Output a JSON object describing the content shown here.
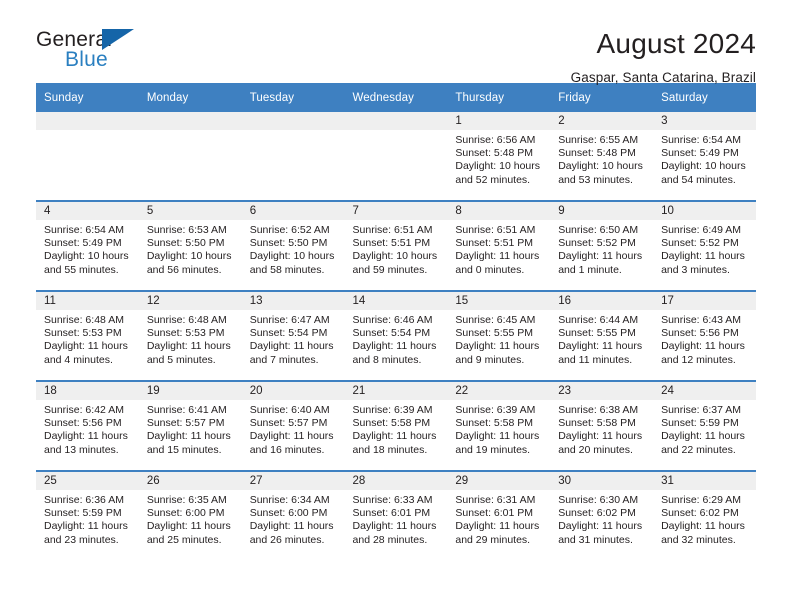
{
  "brand": {
    "name_part1": "General",
    "name_part2": "Blue",
    "flag_icon": "blue-flag-triangle",
    "accent_color": "#2a7fc0"
  },
  "header": {
    "title": "August 2024",
    "subtitle": "Gaspar, Santa Catarina, Brazil"
  },
  "calendar": {
    "header_bg": "#3e80c1",
    "daynum_bg": "#efefef",
    "weekday_headers": [
      "Sunday",
      "Monday",
      "Tuesday",
      "Wednesday",
      "Thursday",
      "Friday",
      "Saturday"
    ],
    "labels": {
      "sunrise": "Sunrise:",
      "sunset": "Sunset:",
      "daylight": "Daylight:"
    },
    "weeks": [
      [
        {
          "day": "",
          "sunrise": "",
          "sunset": "",
          "daylight": ""
        },
        {
          "day": "",
          "sunrise": "",
          "sunset": "",
          "daylight": ""
        },
        {
          "day": "",
          "sunrise": "",
          "sunset": "",
          "daylight": ""
        },
        {
          "day": "",
          "sunrise": "",
          "sunset": "",
          "daylight": ""
        },
        {
          "day": "1",
          "sunrise": "Sunrise: 6:56 AM",
          "sunset": "Sunset: 5:48 PM",
          "daylight": "Daylight: 10 hours and 52 minutes."
        },
        {
          "day": "2",
          "sunrise": "Sunrise: 6:55 AM",
          "sunset": "Sunset: 5:48 PM",
          "daylight": "Daylight: 10 hours and 53 minutes."
        },
        {
          "day": "3",
          "sunrise": "Sunrise: 6:54 AM",
          "sunset": "Sunset: 5:49 PM",
          "daylight": "Daylight: 10 hours and 54 minutes."
        }
      ],
      [
        {
          "day": "4",
          "sunrise": "Sunrise: 6:54 AM",
          "sunset": "Sunset: 5:49 PM",
          "daylight": "Daylight: 10 hours and 55 minutes."
        },
        {
          "day": "5",
          "sunrise": "Sunrise: 6:53 AM",
          "sunset": "Sunset: 5:50 PM",
          "daylight": "Daylight: 10 hours and 56 minutes."
        },
        {
          "day": "6",
          "sunrise": "Sunrise: 6:52 AM",
          "sunset": "Sunset: 5:50 PM",
          "daylight": "Daylight: 10 hours and 58 minutes."
        },
        {
          "day": "7",
          "sunrise": "Sunrise: 6:51 AM",
          "sunset": "Sunset: 5:51 PM",
          "daylight": "Daylight: 10 hours and 59 minutes."
        },
        {
          "day": "8",
          "sunrise": "Sunrise: 6:51 AM",
          "sunset": "Sunset: 5:51 PM",
          "daylight": "Daylight: 11 hours and 0 minutes."
        },
        {
          "day": "9",
          "sunrise": "Sunrise: 6:50 AM",
          "sunset": "Sunset: 5:52 PM",
          "daylight": "Daylight: 11 hours and 1 minute."
        },
        {
          "day": "10",
          "sunrise": "Sunrise: 6:49 AM",
          "sunset": "Sunset: 5:52 PM",
          "daylight": "Daylight: 11 hours and 3 minutes."
        }
      ],
      [
        {
          "day": "11",
          "sunrise": "Sunrise: 6:48 AM",
          "sunset": "Sunset: 5:53 PM",
          "daylight": "Daylight: 11 hours and 4 minutes."
        },
        {
          "day": "12",
          "sunrise": "Sunrise: 6:48 AM",
          "sunset": "Sunset: 5:53 PM",
          "daylight": "Daylight: 11 hours and 5 minutes."
        },
        {
          "day": "13",
          "sunrise": "Sunrise: 6:47 AM",
          "sunset": "Sunset: 5:54 PM",
          "daylight": "Daylight: 11 hours and 7 minutes."
        },
        {
          "day": "14",
          "sunrise": "Sunrise: 6:46 AM",
          "sunset": "Sunset: 5:54 PM",
          "daylight": "Daylight: 11 hours and 8 minutes."
        },
        {
          "day": "15",
          "sunrise": "Sunrise: 6:45 AM",
          "sunset": "Sunset: 5:55 PM",
          "daylight": "Daylight: 11 hours and 9 minutes."
        },
        {
          "day": "16",
          "sunrise": "Sunrise: 6:44 AM",
          "sunset": "Sunset: 5:55 PM",
          "daylight": "Daylight: 11 hours and 11 minutes."
        },
        {
          "day": "17",
          "sunrise": "Sunrise: 6:43 AM",
          "sunset": "Sunset: 5:56 PM",
          "daylight": "Daylight: 11 hours and 12 minutes."
        }
      ],
      [
        {
          "day": "18",
          "sunrise": "Sunrise: 6:42 AM",
          "sunset": "Sunset: 5:56 PM",
          "daylight": "Daylight: 11 hours and 13 minutes."
        },
        {
          "day": "19",
          "sunrise": "Sunrise: 6:41 AM",
          "sunset": "Sunset: 5:57 PM",
          "daylight": "Daylight: 11 hours and 15 minutes."
        },
        {
          "day": "20",
          "sunrise": "Sunrise: 6:40 AM",
          "sunset": "Sunset: 5:57 PM",
          "daylight": "Daylight: 11 hours and 16 minutes."
        },
        {
          "day": "21",
          "sunrise": "Sunrise: 6:39 AM",
          "sunset": "Sunset: 5:58 PM",
          "daylight": "Daylight: 11 hours and 18 minutes."
        },
        {
          "day": "22",
          "sunrise": "Sunrise: 6:39 AM",
          "sunset": "Sunset: 5:58 PM",
          "daylight": "Daylight: 11 hours and 19 minutes."
        },
        {
          "day": "23",
          "sunrise": "Sunrise: 6:38 AM",
          "sunset": "Sunset: 5:58 PM",
          "daylight": "Daylight: 11 hours and 20 minutes."
        },
        {
          "day": "24",
          "sunrise": "Sunrise: 6:37 AM",
          "sunset": "Sunset: 5:59 PM",
          "daylight": "Daylight: 11 hours and 22 minutes."
        }
      ],
      [
        {
          "day": "25",
          "sunrise": "Sunrise: 6:36 AM",
          "sunset": "Sunset: 5:59 PM",
          "daylight": "Daylight: 11 hours and 23 minutes."
        },
        {
          "day": "26",
          "sunrise": "Sunrise: 6:35 AM",
          "sunset": "Sunset: 6:00 PM",
          "daylight": "Daylight: 11 hours and 25 minutes."
        },
        {
          "day": "27",
          "sunrise": "Sunrise: 6:34 AM",
          "sunset": "Sunset: 6:00 PM",
          "daylight": "Daylight: 11 hours and 26 minutes."
        },
        {
          "day": "28",
          "sunrise": "Sunrise: 6:33 AM",
          "sunset": "Sunset: 6:01 PM",
          "daylight": "Daylight: 11 hours and 28 minutes."
        },
        {
          "day": "29",
          "sunrise": "Sunrise: 6:31 AM",
          "sunset": "Sunset: 6:01 PM",
          "daylight": "Daylight: 11 hours and 29 minutes."
        },
        {
          "day": "30",
          "sunrise": "Sunrise: 6:30 AM",
          "sunset": "Sunset: 6:02 PM",
          "daylight": "Daylight: 11 hours and 31 minutes."
        },
        {
          "day": "31",
          "sunrise": "Sunrise: 6:29 AM",
          "sunset": "Sunset: 6:02 PM",
          "daylight": "Daylight: 11 hours and 32 minutes."
        }
      ]
    ]
  }
}
